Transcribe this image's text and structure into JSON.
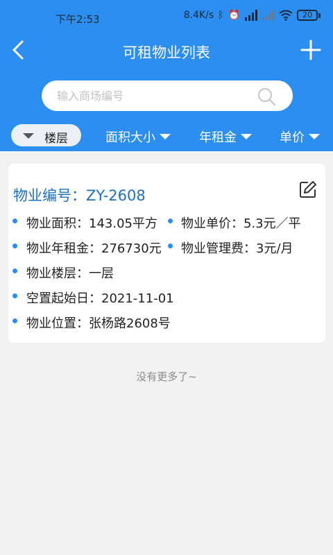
{
  "status_bar": {
    "time": "下午2:53",
    "network_speed": "8.4K/s",
    "battery": "20"
  },
  "header": {
    "title": "可租物业列表",
    "back_icon": "chevron-left-icon",
    "add_icon": "plus-icon"
  },
  "search": {
    "placeholder": "输入商场编号",
    "value": ""
  },
  "filters": [
    {
      "label": "楼层",
      "active": true
    },
    {
      "label": "面积大小"
    },
    {
      "label": "年租金"
    },
    {
      "label": "单价"
    }
  ],
  "property": {
    "title": "物业编号：ZY-2608",
    "area": "物业面积：143.05平方",
    "unit_price": "物业单价：5.3元／平",
    "annual_rent": "物业年租金：276730元",
    "mgmt_fee": "物业管理费：3元/月",
    "floor": "物业楼层：一层",
    "vacancy_date": "空置起始日：2021-11-01",
    "location": "物业位置：张杨路2608号"
  },
  "footer": {
    "no_more": "没有更多了~"
  },
  "colors": {
    "primary": "#2b8ef0",
    "title_blue": "#1a6fc9",
    "background": "#f2f2f2"
  }
}
